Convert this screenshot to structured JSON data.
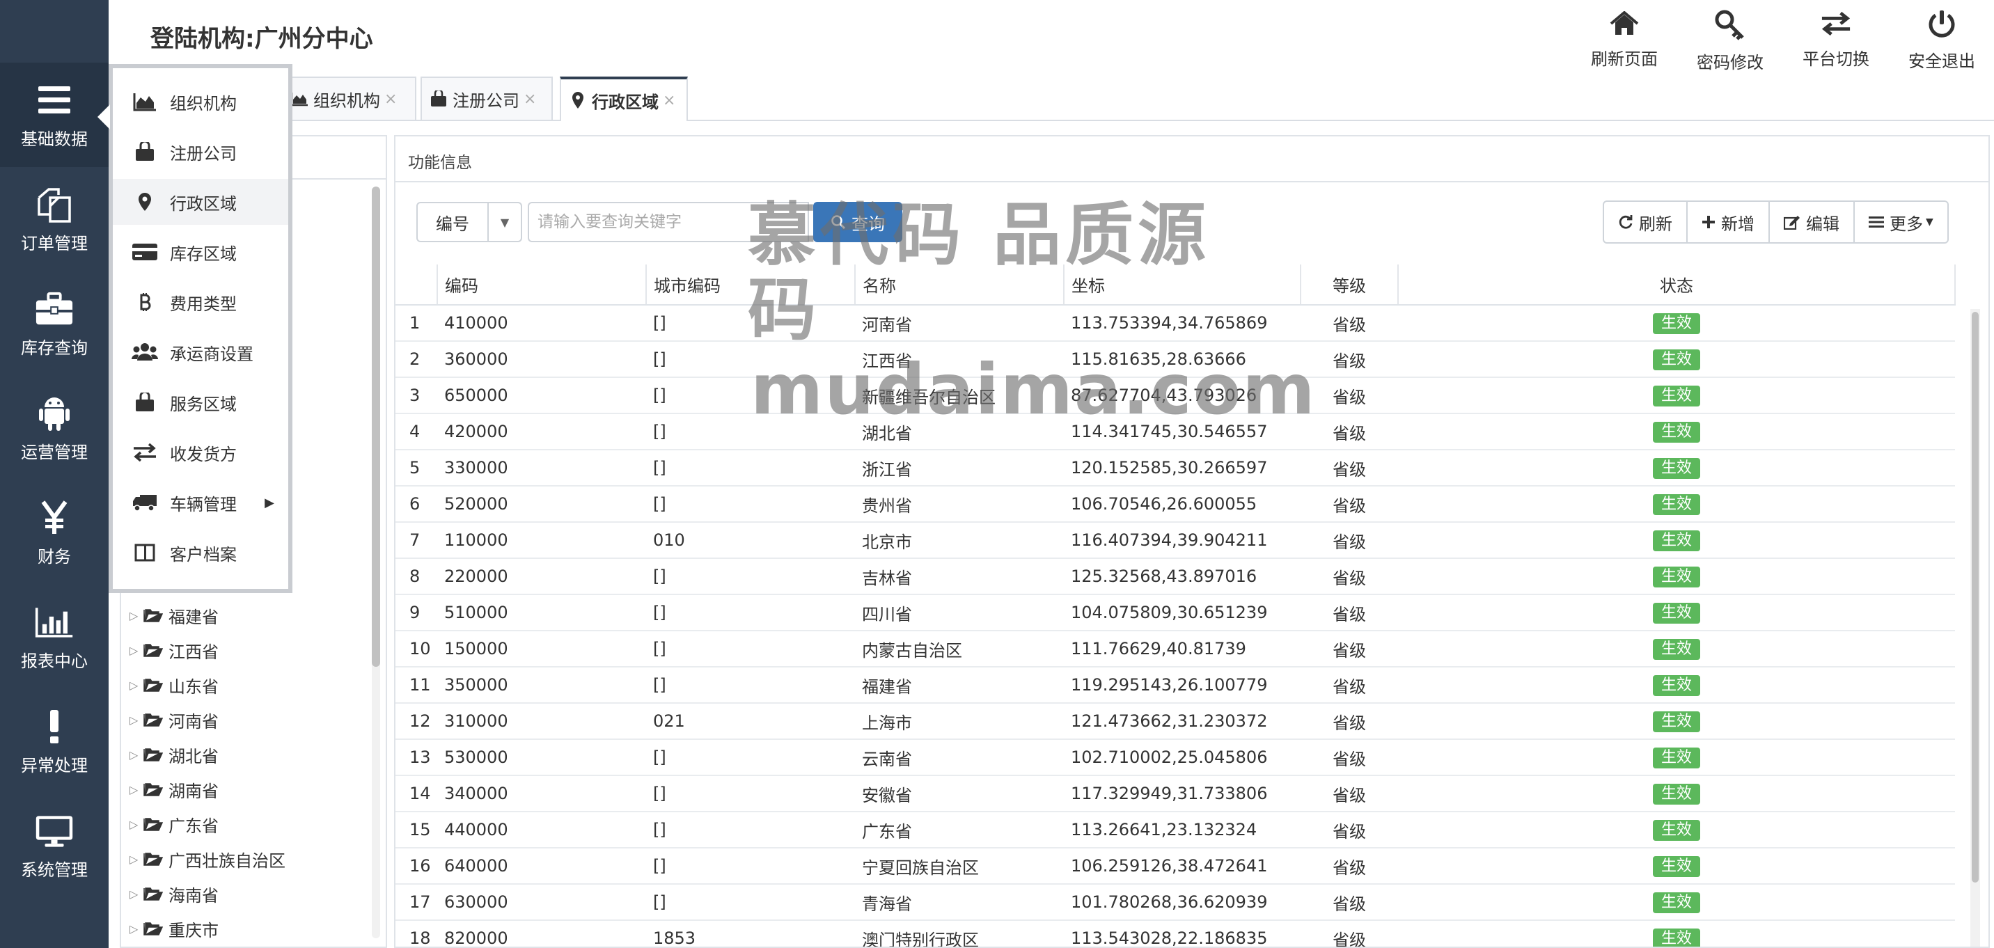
{
  "header": {
    "title": "登陆机构:广州分中心",
    "actions": [
      {
        "label": "刷新页面",
        "icon": "home-icon"
      },
      {
        "label": "密码修改",
        "icon": "key-icon"
      },
      {
        "label": "平台切换",
        "icon": "swap-icon"
      },
      {
        "label": "安全退出",
        "icon": "power-icon"
      }
    ]
  },
  "sidebar": {
    "items": [
      {
        "label": "基础数据",
        "icon": "menu-icon",
        "active": true
      },
      {
        "label": "订单管理",
        "icon": "copy-icon"
      },
      {
        "label": "库存查询",
        "icon": "briefcase-icon"
      },
      {
        "label": "运营管理",
        "icon": "android-icon"
      },
      {
        "label": "财务",
        "icon": "yen-icon"
      },
      {
        "label": "报表中心",
        "icon": "bar-chart-icon"
      },
      {
        "label": "异常处理",
        "icon": "exclamation-icon"
      },
      {
        "label": "系统管理",
        "icon": "monitor-icon"
      }
    ]
  },
  "tabs": [
    {
      "label": "组织机构",
      "icon": "area-chart-icon"
    },
    {
      "label": "注册公司",
      "icon": "bag-icon"
    },
    {
      "label": "行政区域",
      "icon": "map-marker-icon",
      "active": true
    }
  ],
  "dropdown": {
    "items": [
      {
        "label": "组织机构",
        "icon": "area-chart-icon"
      },
      {
        "label": "注册公司",
        "icon": "bag-icon"
      },
      {
        "label": "行政区域",
        "icon": "map-marker-icon",
        "active": true
      },
      {
        "label": "库存区域",
        "icon": "credit-card-icon"
      },
      {
        "label": "费用类型",
        "icon": "bitcoin-icon"
      },
      {
        "label": "承运商设置",
        "icon": "users-icon"
      },
      {
        "label": "服务区域",
        "icon": "bag-icon"
      },
      {
        "label": "收发货方",
        "icon": "exchange-icon"
      },
      {
        "label": "车辆管理",
        "icon": "truck-icon",
        "has_submenu": true
      },
      {
        "label": "客户档案",
        "icon": "columns-icon"
      }
    ]
  },
  "tree": {
    "nodes": [
      "福建省",
      "江西省",
      "山东省",
      "河南省",
      "湖北省",
      "湖南省",
      "广东省",
      "广西壮族自治区",
      "海南省",
      "重庆市"
    ]
  },
  "panel": {
    "title": "功能信息",
    "field_select": "编号",
    "search_placeholder": "请输入要查询关键字",
    "search_button": "查询",
    "buttons": {
      "refresh": "刷新",
      "add": "新增",
      "edit": "编辑",
      "more": "更多"
    }
  },
  "table": {
    "columns": [
      "",
      "编码",
      "城市编码",
      "名称",
      "坐标",
      "等级",
      "状态"
    ],
    "rows": [
      {
        "no": "1",
        "code": "410000",
        "city_code": "[]",
        "name": "河南省",
        "coord": "113.753394,34.765869",
        "level": "省级",
        "status": "生效"
      },
      {
        "no": "2",
        "code": "360000",
        "city_code": "[]",
        "name": "江西省",
        "coord": "115.81635,28.63666",
        "level": "省级",
        "status": "生效"
      },
      {
        "no": "3",
        "code": "650000",
        "city_code": "[]",
        "name": "新疆维吾尔自治区",
        "coord": "87.627704,43.793026",
        "level": "省级",
        "status": "生效"
      },
      {
        "no": "4",
        "code": "420000",
        "city_code": "[]",
        "name": "湖北省",
        "coord": "114.341745,30.546557",
        "level": "省级",
        "status": "生效"
      },
      {
        "no": "5",
        "code": "330000",
        "city_code": "[]",
        "name": "浙江省",
        "coord": "120.152585,30.266597",
        "level": "省级",
        "status": "生效"
      },
      {
        "no": "6",
        "code": "520000",
        "city_code": "[]",
        "name": "贵州省",
        "coord": "106.70546,26.600055",
        "level": "省级",
        "status": "生效"
      },
      {
        "no": "7",
        "code": "110000",
        "city_code": "010",
        "name": "北京市",
        "coord": "116.407394,39.904211",
        "level": "省级",
        "status": "生效"
      },
      {
        "no": "8",
        "code": "220000",
        "city_code": "[]",
        "name": "吉林省",
        "coord": "125.32568,43.897016",
        "level": "省级",
        "status": "生效"
      },
      {
        "no": "9",
        "code": "510000",
        "city_code": "[]",
        "name": "四川省",
        "coord": "104.075809,30.651239",
        "level": "省级",
        "status": "生效"
      },
      {
        "no": "10",
        "code": "150000",
        "city_code": "[]",
        "name": "内蒙古自治区",
        "coord": "111.76629,40.81739",
        "level": "省级",
        "status": "生效"
      },
      {
        "no": "11",
        "code": "350000",
        "city_code": "[]",
        "name": "福建省",
        "coord": "119.295143,26.100779",
        "level": "省级",
        "status": "生效"
      },
      {
        "no": "12",
        "code": "310000",
        "city_code": "021",
        "name": "上海市",
        "coord": "121.473662,31.230372",
        "level": "省级",
        "status": "生效"
      },
      {
        "no": "13",
        "code": "530000",
        "city_code": "[]",
        "name": "云南省",
        "coord": "102.710002,25.045806",
        "level": "省级",
        "status": "生效"
      },
      {
        "no": "14",
        "code": "340000",
        "city_code": "[]",
        "name": "安徽省",
        "coord": "117.329949,31.733806",
        "level": "省级",
        "status": "生效"
      },
      {
        "no": "15",
        "code": "440000",
        "city_code": "[]",
        "name": "广东省",
        "coord": "113.26641,23.132324",
        "level": "省级",
        "status": "生效"
      },
      {
        "no": "16",
        "code": "640000",
        "city_code": "[]",
        "name": "宁夏回族自治区",
        "coord": "106.259126,38.472641",
        "level": "省级",
        "status": "生效"
      },
      {
        "no": "17",
        "code": "630000",
        "city_code": "[]",
        "name": "青海省",
        "coord": "101.780268,36.620939",
        "level": "省级",
        "status": "生效"
      },
      {
        "no": "18",
        "code": "820000",
        "city_code": "1853",
        "name": "澳门特别行政区",
        "coord": "113.543028,22.186835",
        "level": "省级",
        "status": "生效"
      }
    ]
  },
  "watermark": {
    "line1": "慕代码 品质源码",
    "line2": "mudaima.com"
  },
  "colors": {
    "sidebar_bg": "#2f3e51",
    "primary": "#3a76b8",
    "status_active": "#5cb85c"
  }
}
